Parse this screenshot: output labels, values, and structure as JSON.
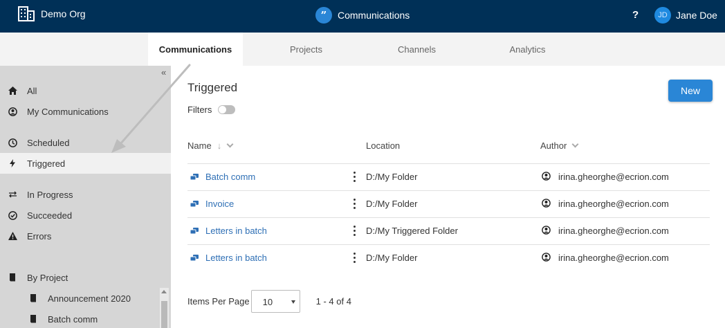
{
  "header": {
    "org_name": "Demo Org",
    "app_title": "Communications",
    "app_icon_glyph": "”",
    "help_label": "?",
    "user_initials": "JD",
    "user_name": "Jane Doe"
  },
  "tabs": [
    {
      "label": "Communications",
      "active": true
    },
    {
      "label": "Projects",
      "active": false
    },
    {
      "label": "Channels",
      "active": false
    },
    {
      "label": "Analytics",
      "active": false
    }
  ],
  "sidebar": {
    "collapse_label": "«",
    "items": [
      {
        "label": "All",
        "icon": "home-icon"
      },
      {
        "label": "My Communications",
        "icon": "user-circle-icon"
      },
      {
        "label": "Scheduled",
        "icon": "clock-icon"
      },
      {
        "label": "Triggered",
        "icon": "bolt-icon",
        "selected": true
      },
      {
        "label": "In Progress",
        "icon": "exchange-icon"
      },
      {
        "label": "Succeeded",
        "icon": "check-circle-icon"
      },
      {
        "label": "Errors",
        "icon": "warning-icon"
      },
      {
        "label": "By Project",
        "icon": "book-icon"
      },
      {
        "label": "Announcement 2020",
        "icon": "book-icon"
      },
      {
        "label": "Batch comm",
        "icon": "book-icon"
      }
    ]
  },
  "main": {
    "title": "Triggered",
    "filters_label": "Filters",
    "new_button": "New",
    "columns": {
      "name": "Name",
      "location": "Location",
      "author": "Author"
    },
    "sort_glyph": "↓",
    "rows": [
      {
        "name": "Batch comm",
        "location": "D:/My Folder",
        "author": "irina.gheorghe@ecrion.com"
      },
      {
        "name": "Invoice",
        "location": "D:/My Folder",
        "author": "irina.gheorghe@ecrion.com"
      },
      {
        "name": "Letters in batch",
        "location": "D:/My Triggered Folder",
        "author": "irina.gheorghe@ecrion.com"
      },
      {
        "name": "Letters in batch",
        "location": "D:/My Folder",
        "author": "irina.gheorghe@ecrion.com"
      }
    ],
    "pager": {
      "label": "Items Per Page",
      "per_page": "10",
      "range": "1 - 4 of 4"
    }
  },
  "colors": {
    "header_bg": "#003057",
    "accent": "#2a86d6",
    "link": "#2e6fb5",
    "sidebar_bg": "#d6d6d6"
  }
}
